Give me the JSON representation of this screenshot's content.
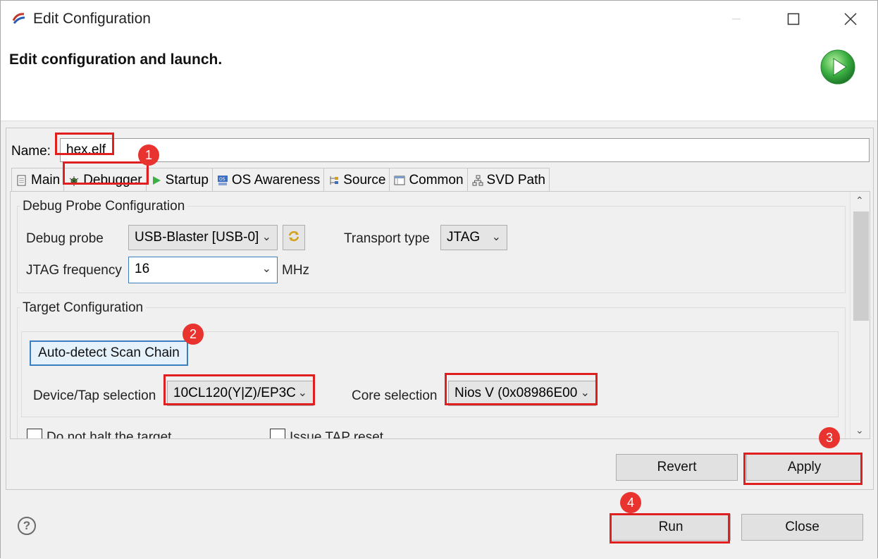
{
  "window": {
    "title": "Edit Configuration",
    "header_title": "Edit configuration and launch.",
    "minimize_icon": "minimize-icon",
    "maximize_icon": "maximize-icon",
    "close_icon": "close-icon"
  },
  "name": {
    "label": "Name:",
    "value": "hex.elf"
  },
  "tabs": [
    {
      "label": "Main",
      "icon": "document-icon"
    },
    {
      "label": "Debugger",
      "icon": "bug-icon"
    },
    {
      "label": "Startup",
      "icon": "play-icon"
    },
    {
      "label": "OS Awareness",
      "icon": "os-icon"
    },
    {
      "label": "Source",
      "icon": "source-icon"
    },
    {
      "label": "Common",
      "icon": "common-icon"
    },
    {
      "label": "SVD Path",
      "icon": "svd-icon"
    }
  ],
  "debug_probe_config": {
    "title": "Debug Probe Configuration",
    "probe_label": "Debug probe",
    "probe_value": "USB-Blaster [USB-0]",
    "transport_label": "Transport type",
    "transport_value": "JTAG",
    "jtag_freq_label": "JTAG frequency",
    "jtag_freq_value": "16",
    "jtag_freq_unit": "MHz"
  },
  "target_config": {
    "title": "Target Configuration",
    "auto_detect_label": "Auto-detect Scan Chain",
    "device_label": "Device/Tap selection",
    "device_value": "10CL120(Y|Z)/EP3C",
    "core_label": "Core selection",
    "core_value": "Nios V (0x08986E00",
    "no_halt_label": "Do not halt the target",
    "tap_reset_label": "Issue TAP reset"
  },
  "buttons": {
    "revert": "Revert",
    "apply": "Apply",
    "run": "Run",
    "close": "Close"
  },
  "markers": [
    "1",
    "2",
    "3",
    "4"
  ],
  "colors": {
    "highlight": "#e02020",
    "marker": "#e8332f",
    "run_green": "#3cb043"
  }
}
